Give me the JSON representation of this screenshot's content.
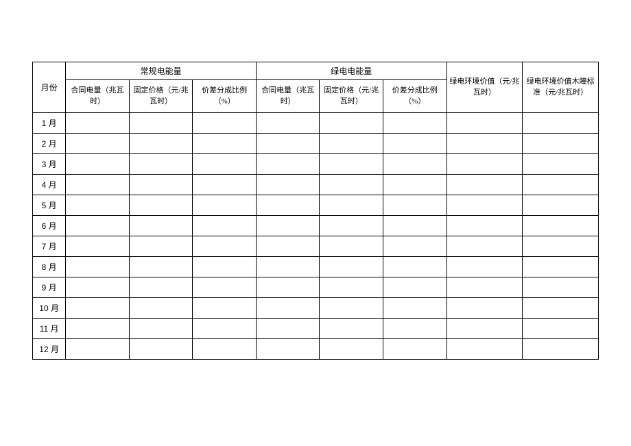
{
  "headers": {
    "month": "月份",
    "group_regular": "常规电能量",
    "group_green": "绿电电能量",
    "regular": {
      "contract_qty": "合同电量（兆瓦时）",
      "fixed_price": "固定价格（元/兆瓦时）",
      "diff_ratio": "价差分成比例（%）"
    },
    "green": {
      "contract_qty": "合同电量（兆瓦时）",
      "fixed_price": "固定价格（元/兆瓦时）",
      "diff_ratio": "价差分成比例（%）"
    },
    "env_value": "绿电环境价值（元/兆瓦时）",
    "env_value_std": "绿电环境价值木瞳标准（元/兆瓦时）"
  },
  "rows": [
    {
      "month": "1 月",
      "reg_qty": "",
      "reg_price": "",
      "reg_ratio": "",
      "grn_qty": "",
      "grn_price": "",
      "grn_ratio": "",
      "env_val": "",
      "env_std": ""
    },
    {
      "month": "2 月",
      "reg_qty": "",
      "reg_price": "",
      "reg_ratio": "",
      "grn_qty": "",
      "grn_price": "",
      "grn_ratio": "",
      "env_val": "",
      "env_std": ""
    },
    {
      "month": "3 月",
      "reg_qty": "",
      "reg_price": "",
      "reg_ratio": "",
      "grn_qty": "",
      "grn_price": "",
      "grn_ratio": "",
      "env_val": "",
      "env_std": ""
    },
    {
      "month": "4 月",
      "reg_qty": "",
      "reg_price": "",
      "reg_ratio": "",
      "grn_qty": "",
      "grn_price": "",
      "grn_ratio": "",
      "env_val": "",
      "env_std": ""
    },
    {
      "month": "5 月",
      "reg_qty": "",
      "reg_price": "",
      "reg_ratio": "",
      "grn_qty": "",
      "grn_price": "",
      "grn_ratio": "",
      "env_val": "",
      "env_std": ""
    },
    {
      "month": "6 月",
      "reg_qty": "",
      "reg_price": "",
      "reg_ratio": "",
      "grn_qty": "",
      "grn_price": "",
      "grn_ratio": "",
      "env_val": "",
      "env_std": ""
    },
    {
      "month": "7 月",
      "reg_qty": "",
      "reg_price": "",
      "reg_ratio": "",
      "grn_qty": "",
      "grn_price": "",
      "grn_ratio": "",
      "env_val": "",
      "env_std": ""
    },
    {
      "month": "8 月",
      "reg_qty": "",
      "reg_price": "",
      "reg_ratio": "",
      "grn_qty": "",
      "grn_price": "",
      "grn_ratio": "",
      "env_val": "",
      "env_std": ""
    },
    {
      "month": "9 月",
      "reg_qty": "",
      "reg_price": "",
      "reg_ratio": "",
      "grn_qty": "",
      "grn_price": "",
      "grn_ratio": "",
      "env_val": "",
      "env_std": ""
    },
    {
      "month": "10 月",
      "reg_qty": "",
      "reg_price": "",
      "reg_ratio": "",
      "grn_qty": "",
      "grn_price": "",
      "grn_ratio": "",
      "env_val": "",
      "env_std": ""
    },
    {
      "month": "11 月",
      "reg_qty": "",
      "reg_price": "",
      "reg_ratio": "",
      "grn_qty": "",
      "grn_price": "",
      "grn_ratio": "",
      "env_val": "",
      "env_std": ""
    },
    {
      "month": "12 月",
      "reg_qty": "",
      "reg_price": "",
      "reg_ratio": "",
      "grn_qty": "",
      "grn_price": "",
      "grn_ratio": "",
      "env_val": "",
      "env_std": ""
    }
  ]
}
